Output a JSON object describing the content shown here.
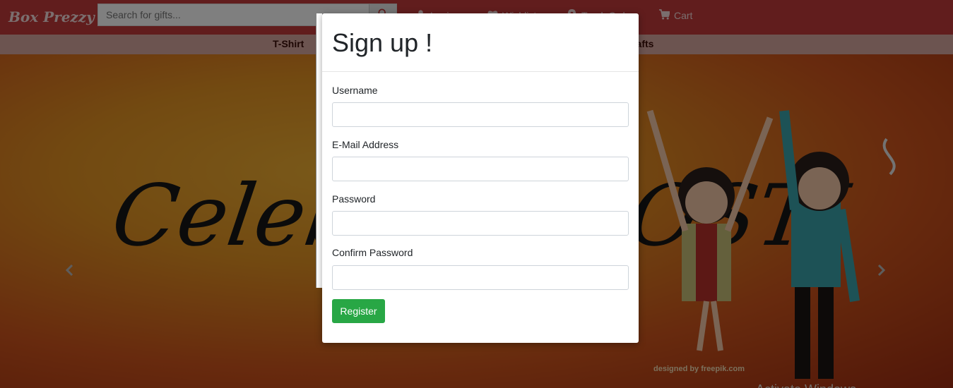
{
  "header": {
    "brand": "Box Prezzy",
    "search": {
      "placeholder": "Search for gifts..."
    },
    "nav": {
      "login": "Login",
      "wishlist": "Wishlist",
      "track_order": "Track Order",
      "cart": "Cart"
    }
  },
  "categories": {
    "tshirt": "T-Shirt",
    "crafts": "Crafts"
  },
  "hero": {
    "text": "Celebrate DOSTI",
    "credit": "designed by freepik.com",
    "watermark": "Activate Windows"
  },
  "modal": {
    "title": "Sign up !",
    "fields": {
      "username": {
        "label": "Username",
        "value": ""
      },
      "email": {
        "label": "E-Mail Address",
        "value": ""
      },
      "password": {
        "label": "Password",
        "value": ""
      },
      "confirm": {
        "label": "Confirm Password",
        "value": ""
      }
    },
    "register_label": "Register"
  },
  "colors": {
    "topbar": "#c23a3a",
    "register": "#28a745",
    "backdrop": "rgba(0,0,0,0.5)"
  },
  "icons": {
    "brand": "gift-icon",
    "search": "search-icon",
    "login": "user-icon",
    "wishlist": "heart-icon",
    "track": "map-marker-icon",
    "cart": "cart-icon"
  }
}
